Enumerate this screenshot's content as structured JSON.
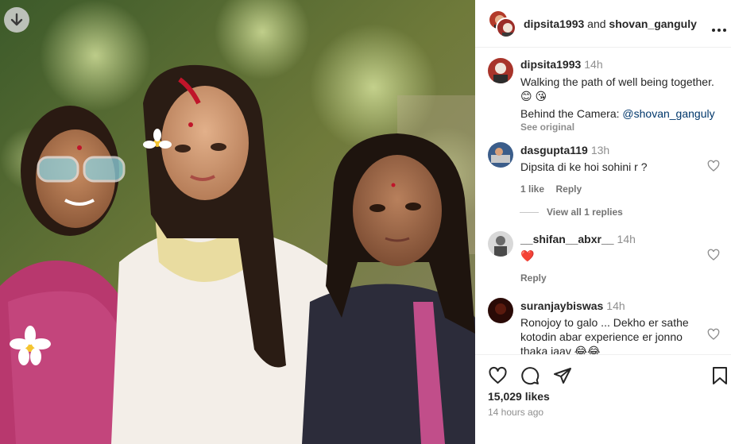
{
  "header": {
    "author": "dipsita1993",
    "joiner": "and",
    "coauthor": "shovan_ganguly",
    "more_icon": "more-horizontal-icon"
  },
  "caption": {
    "username": "dipsita1993",
    "time": "14h",
    "line1": "Walking the path of well being together.",
    "emoji": "😊 😘",
    "camera_label": "Behind the Camera: ",
    "camera_mention": "@shovan_ganguly",
    "see_original": "See original"
  },
  "comments": [
    {
      "username": "dasgupta119",
      "time": "13h",
      "text": "Dipsita di ke hoi sohini r ?",
      "likes": "1 like",
      "reply": "Reply",
      "view_replies": "View all 1 replies"
    },
    {
      "username": "__shifan__abxr__",
      "time": "14h",
      "text": "❤️",
      "reply": "Reply"
    },
    {
      "username": "suranjaybiswas",
      "time": "14h",
      "text_line1": "Ronojoy to galo ... Dekho er sathe",
      "text_line2": "kotodin abar experience er jonno",
      "text_line3": "thaka jaav 😂😂"
    }
  ],
  "actions": {
    "like_icon": "heart-icon",
    "comment_icon": "comment-icon",
    "share_icon": "send-icon",
    "save_icon": "bookmark-icon"
  },
  "likes": "15,029 likes",
  "posted": "14 hours ago",
  "colors": {
    "mention": "#00376b",
    "muted": "#8e8e8e",
    "border": "#efefef",
    "heart": "#ed4956"
  }
}
